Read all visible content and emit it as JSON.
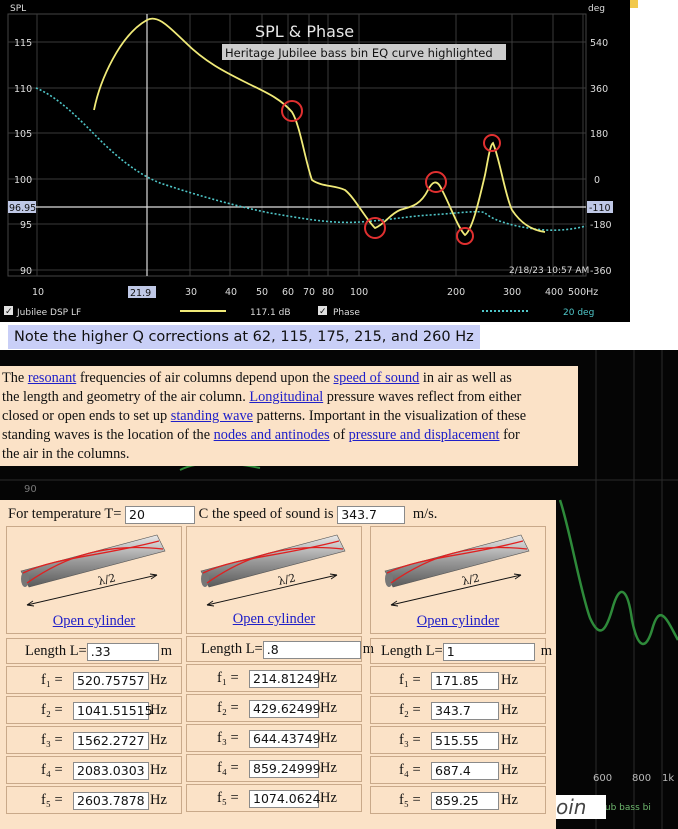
{
  "plot": {
    "title": "SPL & Phase",
    "subtitle": "Heritage Jubilee bass bin EQ curve highlighted",
    "left_axis_label": "SPL",
    "right_axis_label": "deg",
    "left_ticks": [
      "115",
      "110",
      "105",
      "100",
      "95",
      "90"
    ],
    "right_ticks": [
      "540",
      "360",
      "180",
      "0",
      "-180",
      "-360"
    ],
    "cursor_spl": "96.95",
    "cursor_phase": "-110",
    "x_ticks": [
      "10",
      "30",
      "40",
      "50",
      "60",
      "70",
      "80",
      "100",
      "200",
      "300",
      "400",
      "500Hz"
    ],
    "cursor_freq": "21.9",
    "timestamp": "2/18/23 10:57 AM",
    "legend": {
      "series1_name": "Jubilee DSP LF",
      "series1_value": "117.1 dB",
      "series2_name": "Phase",
      "series2_value": "20 deg"
    },
    "colors": {
      "spl": "#f0ea78",
      "phase": "#4fc6c8",
      "highlight": "#e03030"
    }
  },
  "note": "Note the higher Q corrections at 62, 115, 175, 215, and 260 Hz",
  "paragraph": {
    "l1a": "The ",
    "l1_link1": "resonant",
    "l1b": " frequencies of air columns depend upon the ",
    "l1_link2": "speed of sound",
    "l1c": " in air as well as",
    "l2a": "the length and geometry of the air column. ",
    "l2_link": "Longitudinal",
    "l2b": " pressure waves reflect from either",
    "l3a": "closed or open ends to set up ",
    "l3_link": "standing wave",
    "l3b": " patterns. Important in the visualization of these",
    "l4a": "standing waves is the location of the ",
    "l4_link1": "nodes and antinodes",
    "l4b": " of ",
    "l4_link2": "pressure and displacement",
    "l4c": " for",
    "l5": "the air in the columns."
  },
  "calculator": {
    "temp_prefix": "For temperature T=",
    "temp_value": "20",
    "speed_prefix": "C the speed of sound is",
    "speed_value": "343.7",
    "speed_unit": "m/s.",
    "lambda_label": "λ/2",
    "columns": [
      {
        "link": "Open cylinder",
        "length_label": "Length L=",
        "length_value": ".33",
        "length_unit": "m",
        "freqs": [
          {
            "label": "f₁ =",
            "value": "520.75757",
            "unit": "Hz"
          },
          {
            "label": "f₂ =",
            "value": "1041.51515",
            "unit": "Hz"
          },
          {
            "label": "f₃ =",
            "value": "1562.2727",
            "unit": "Hz"
          },
          {
            "label": "f₄ =",
            "value": "2083.0303",
            "unit": "Hz"
          },
          {
            "label": "f₅ =",
            "value": "2603.7878",
            "unit": "Hz"
          }
        ]
      },
      {
        "link": "Open cylinder",
        "length_label": "Length L=",
        "length_value": ".8",
        "length_unit": "m",
        "freqs": [
          {
            "label": "f₁ =",
            "value": "214.81249",
            "unit": "Hz"
          },
          {
            "label": "f₂ =",
            "value": "429.62499",
            "unit": "Hz"
          },
          {
            "label": "f₃ =",
            "value": "644.43749",
            "unit": "Hz"
          },
          {
            "label": "f₄ =",
            "value": "859.24999",
            "unit": "Hz"
          },
          {
            "label": "f₅ =",
            "value": "1074.0624",
            "unit": "Hz"
          }
        ]
      },
      {
        "link": "Open cylinder",
        "length_label": "Length L=",
        "length_value": "1",
        "length_unit": "m",
        "freqs": [
          {
            "label": "f₁ =",
            "value": "171.85",
            "unit": "Hz"
          },
          {
            "label": "f₂ =",
            "value": "343.7",
            "unit": "Hz"
          },
          {
            "label": "f₃ =",
            "value": "515.55",
            "unit": "Hz"
          },
          {
            "label": "f₄ =",
            "value": "687.4",
            "unit": "Hz"
          },
          {
            "label": "f₅ =",
            "value": "859.25",
            "unit": "Hz"
          }
        ]
      }
    ]
  },
  "background_chart": {
    "tick_90": "90",
    "x_ticks": [
      "600",
      "800",
      "1k"
    ],
    "label": "RJub bass bi",
    "logo_text": "oin"
  }
}
